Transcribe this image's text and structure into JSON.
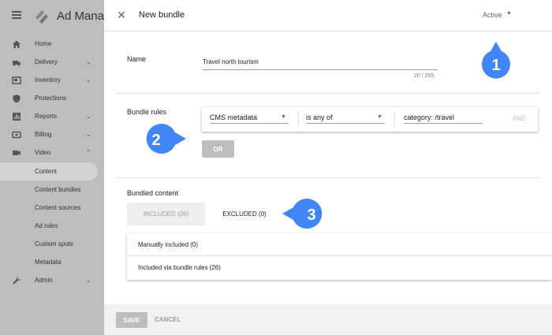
{
  "nav": {
    "brand": "Ad Manag",
    "items": [
      {
        "label": "Home",
        "icon": "home-icon",
        "chevron": ""
      },
      {
        "label": "Delivery",
        "icon": "delivery-icon",
        "chevron": "⌄"
      },
      {
        "label": "Inventory",
        "icon": "inventory-icon",
        "chevron": "⌄"
      },
      {
        "label": "Protections",
        "icon": "shield-icon",
        "chevron": ""
      },
      {
        "label": "Reports",
        "icon": "reports-icon",
        "chevron": "⌄"
      },
      {
        "label": "Billing",
        "icon": "billing-icon",
        "chevron": "⌄"
      },
      {
        "label": "Video",
        "icon": "video-icon",
        "chevron": "⌃"
      }
    ],
    "sub_items": [
      {
        "label": "Content",
        "active": true
      },
      {
        "label": "Content bundles"
      },
      {
        "label": "Content sources"
      },
      {
        "label": "Ad rules"
      },
      {
        "label": "Custom spots"
      },
      {
        "label": "Metadata"
      }
    ],
    "admin": {
      "label": "Admin",
      "icon": "wrench-icon",
      "chevron": "⌄"
    }
  },
  "panel": {
    "title": "New bundle",
    "status": "Active",
    "name_section": {
      "label": "Name",
      "value": "Travel north tourism",
      "counter": "20 / 255"
    },
    "rules_section": {
      "label": "Bundle rules",
      "field": "CMS metadata",
      "operator": "is any of",
      "value": "category: /travel",
      "and_label": "AND",
      "or_label": "OR"
    },
    "content_section": {
      "label": "Bundled content",
      "tab_included": "INCLUDED (26)",
      "tab_excluded": "EXCLUDED (0)",
      "list": [
        "Manually included (0)",
        "Included via bundle rules (26)"
      ]
    },
    "footer": {
      "save_label": "SAVE",
      "cancel_label": "CANCEL"
    }
  },
  "callouts": [
    "1",
    "2",
    "3"
  ],
  "colors": {
    "callout": "#4285f4",
    "nav_bg": "#bdbdbd"
  }
}
